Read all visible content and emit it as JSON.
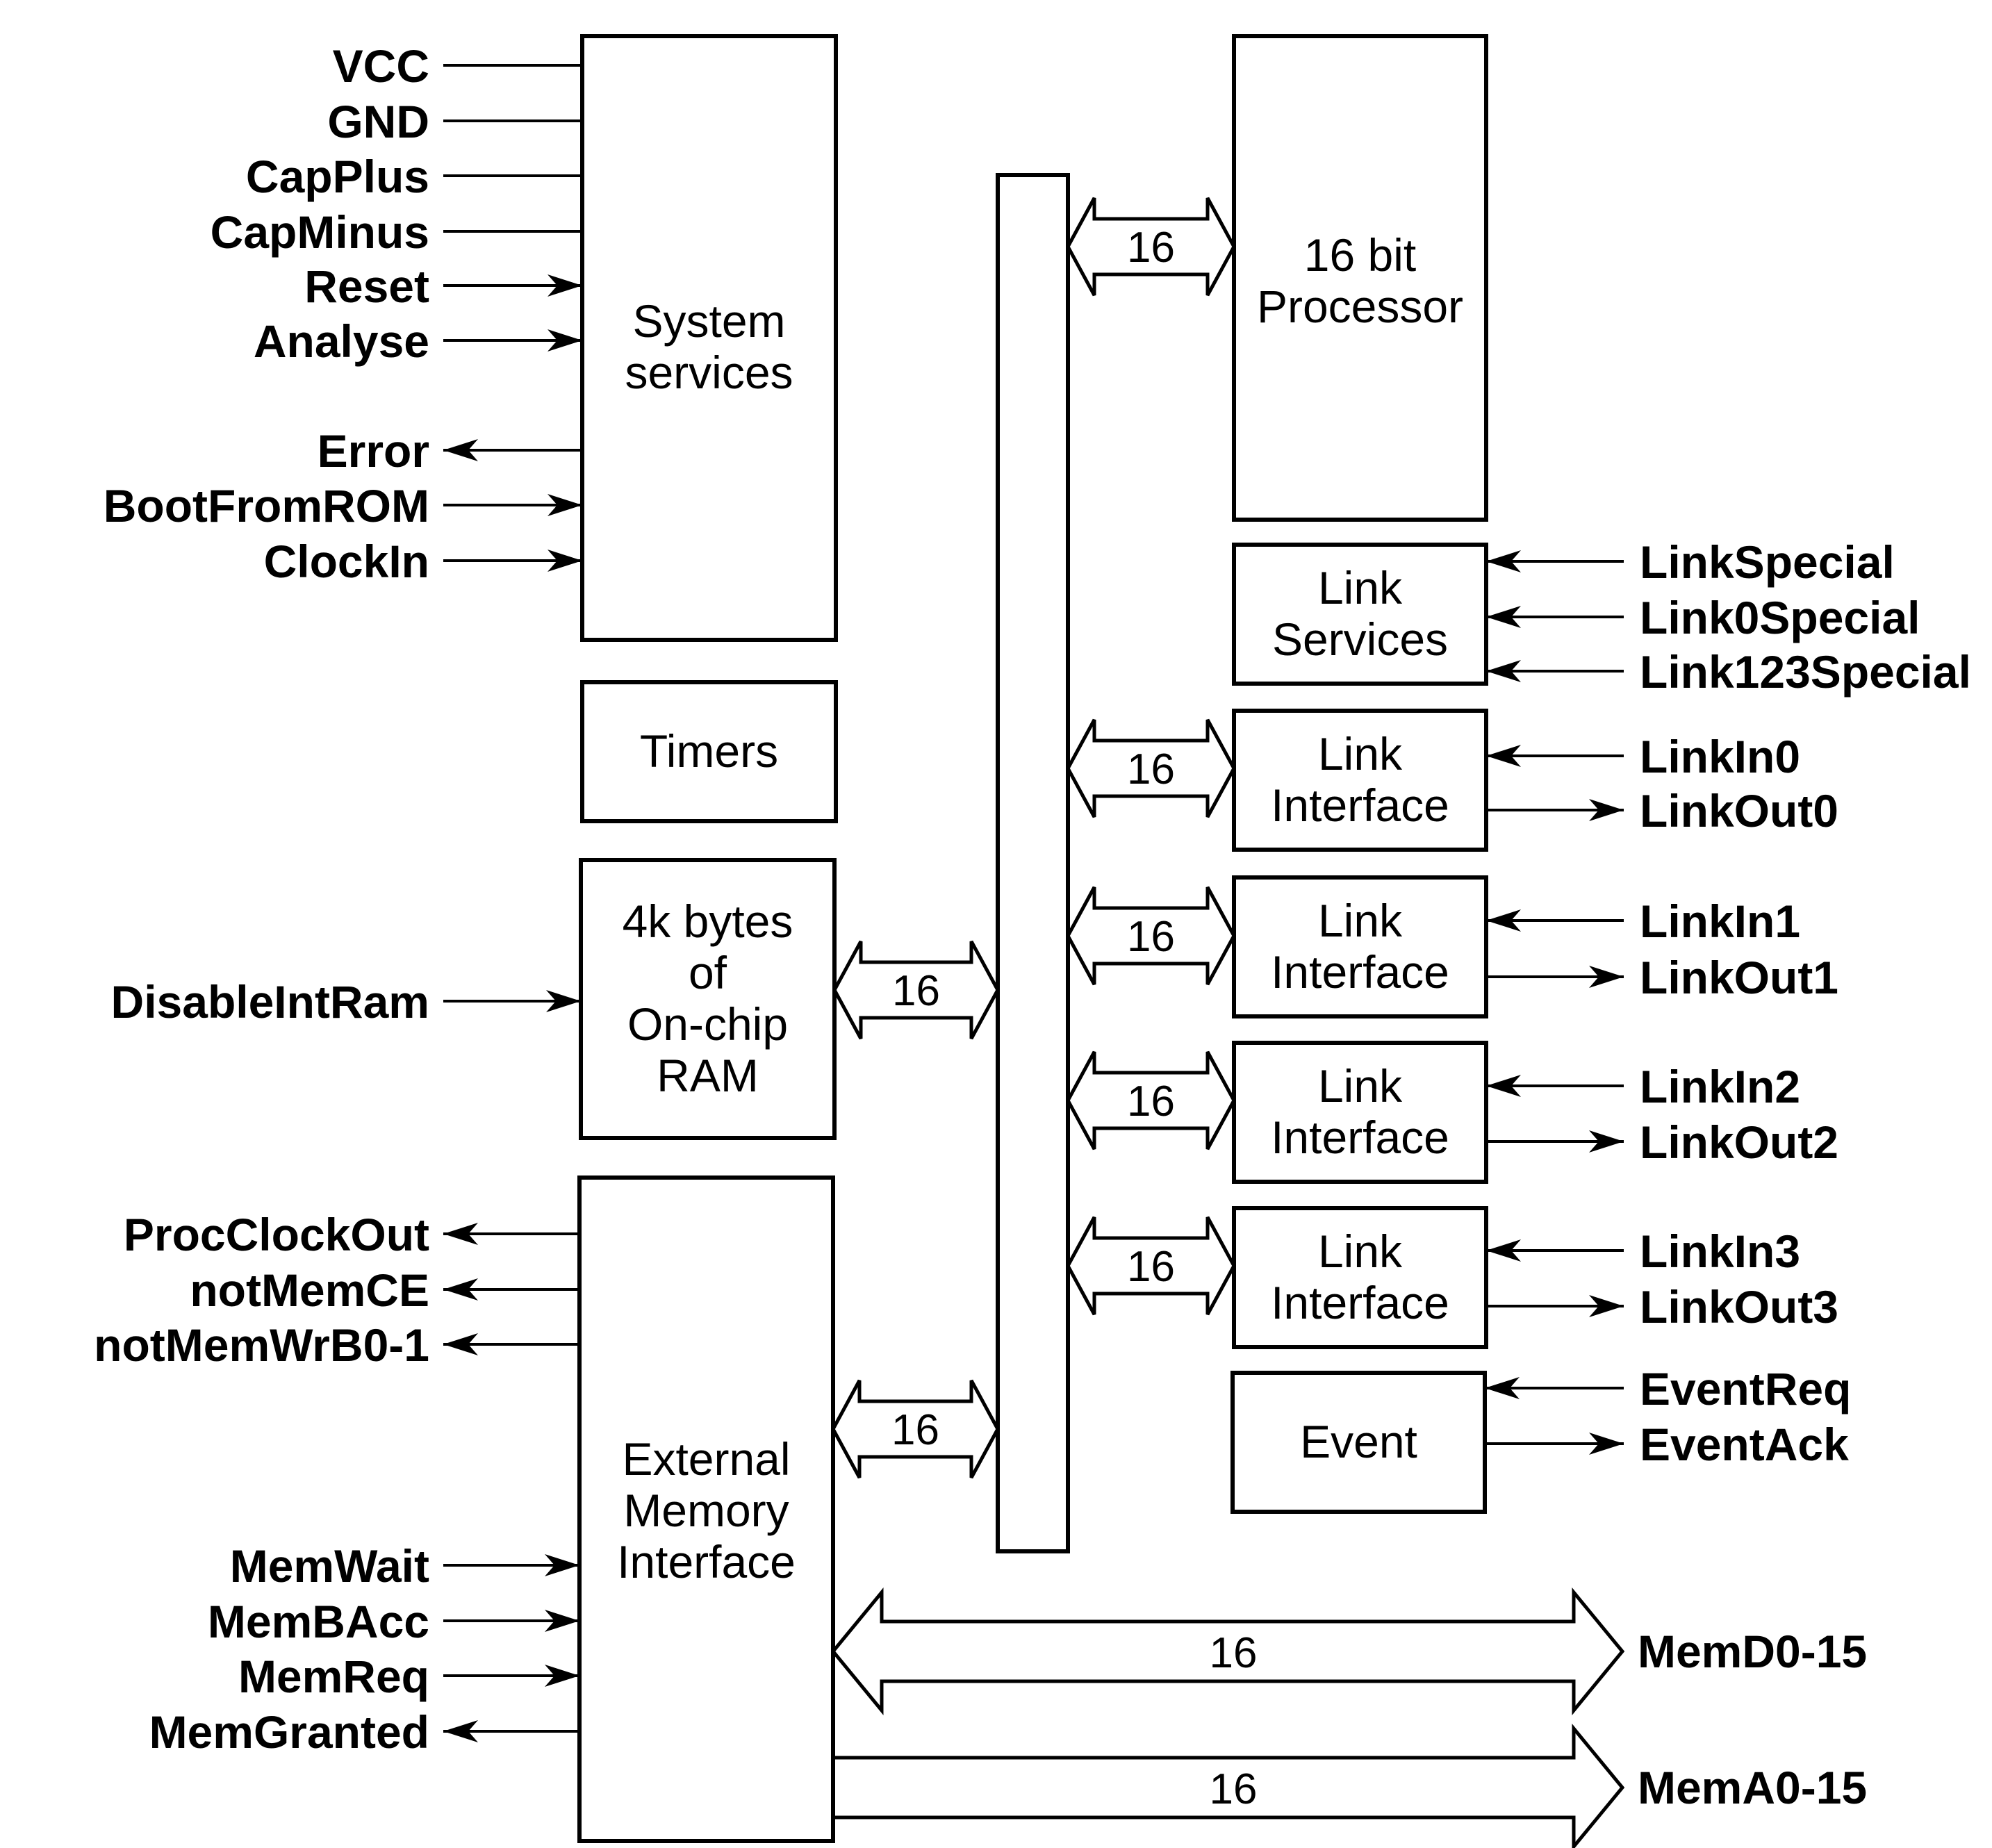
{
  "diagram": {
    "type": "block-diagram",
    "blocks": {
      "system_services": [
        "System",
        "services"
      ],
      "timers": [
        "Timers"
      ],
      "ram": [
        "4k bytes",
        "of",
        "On-chip",
        "RAM"
      ],
      "ext_mem": [
        "External",
        "Memory",
        "Interface"
      ],
      "processor": [
        "16 bit",
        "Processor"
      ],
      "link_services": [
        "Link",
        "Services"
      ],
      "link_if0": [
        "Link",
        "Interface"
      ],
      "link_if1": [
        "Link",
        "Interface"
      ],
      "link_if2": [
        "Link",
        "Interface"
      ],
      "link_if3": [
        "Link",
        "Interface"
      ],
      "event": [
        "Event"
      ]
    },
    "bus_widths": {
      "processor": "16",
      "ram": "16",
      "ext_mem": "16",
      "link_if0": "16",
      "link_if1": "16",
      "link_if2": "16",
      "link_if3": "16",
      "mem_data": "16",
      "mem_addr": "16"
    },
    "left_signals": [
      {
        "name": "VCC",
        "dir": "none"
      },
      {
        "name": "GND",
        "dir": "none"
      },
      {
        "name": "CapPlus",
        "dir": "none"
      },
      {
        "name": "CapMinus",
        "dir": "none"
      },
      {
        "name": "Reset",
        "dir": "in"
      },
      {
        "name": "Analyse",
        "dir": "in"
      },
      {
        "name": "Error",
        "dir": "out"
      },
      {
        "name": "BootFromROM",
        "dir": "in"
      },
      {
        "name": "ClockIn",
        "dir": "in"
      },
      {
        "name": "DisableIntRam",
        "dir": "in"
      },
      {
        "name": "ProcClockOut",
        "dir": "out"
      },
      {
        "name": "notMemCE",
        "dir": "out"
      },
      {
        "name": "notMemWrB0-1",
        "dir": "out"
      },
      {
        "name": "MemWait",
        "dir": "in"
      },
      {
        "name": "MemBAcc",
        "dir": "in"
      },
      {
        "name": "MemReq",
        "dir": "in"
      },
      {
        "name": "MemGranted",
        "dir": "out"
      }
    ],
    "right_signals": [
      {
        "name": "LinkSpecial",
        "dir": "in"
      },
      {
        "name": "Link0Special",
        "dir": "in"
      },
      {
        "name": "Link123Special",
        "dir": "in"
      },
      {
        "name": "LinkIn0",
        "dir": "in"
      },
      {
        "name": "LinkOut0",
        "dir": "out"
      },
      {
        "name": "LinkIn1",
        "dir": "in"
      },
      {
        "name": "LinkOut1",
        "dir": "out"
      },
      {
        "name": "LinkIn2",
        "dir": "in"
      },
      {
        "name": "LinkOut2",
        "dir": "out"
      },
      {
        "name": "LinkIn3",
        "dir": "in"
      },
      {
        "name": "LinkOut3",
        "dir": "out"
      },
      {
        "name": "EventReq",
        "dir": "in"
      },
      {
        "name": "EventAck",
        "dir": "out"
      }
    ],
    "external_buses": {
      "mem_data": "MemD0-15",
      "mem_addr": "MemA0-15"
    }
  }
}
